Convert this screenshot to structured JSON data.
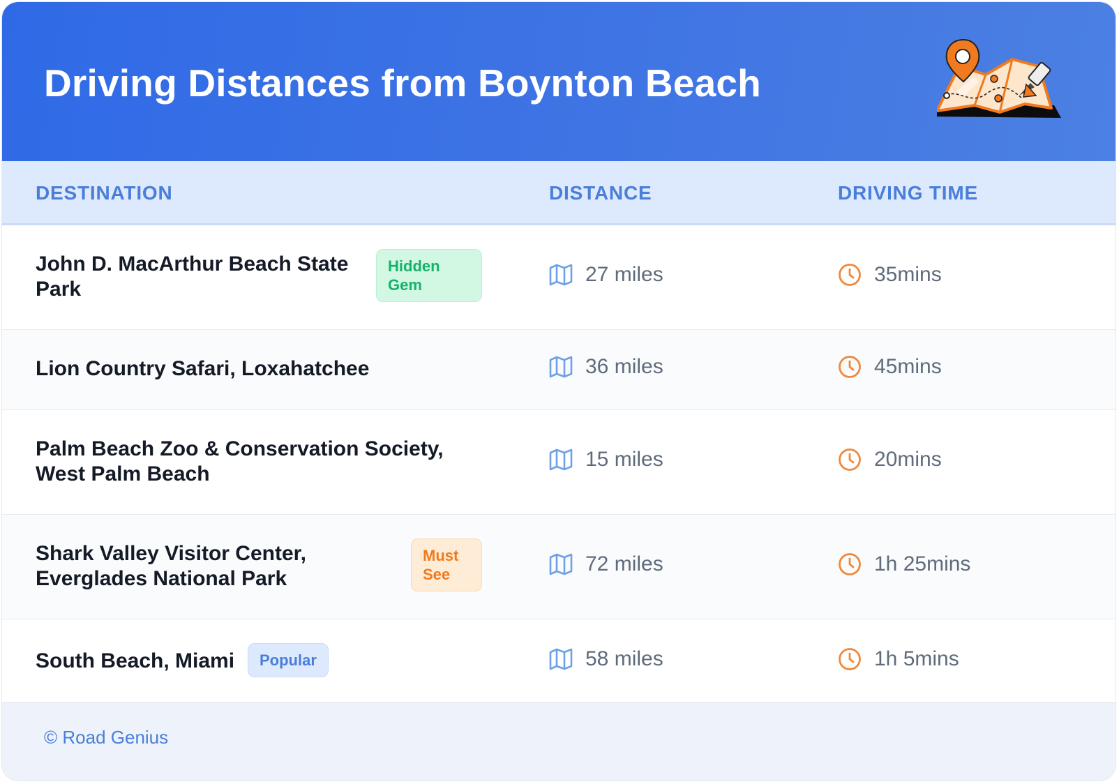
{
  "header": {
    "title": "Driving Distances from Boynton Beach",
    "illustration_icon": "map-with-pins-icon"
  },
  "columns": {
    "destination": "DESTINATION",
    "distance": "DISTANCE",
    "driving_time": "DRIVING TIME"
  },
  "rows": [
    {
      "destination": "John D. MacArthur Beach State Park",
      "badge": "Hidden Gem",
      "badge_color": "#17b26a",
      "distance": "27 miles",
      "time": "35mins"
    },
    {
      "destination": "Lion Country Safari, Loxahatchee",
      "badge": "",
      "distance": "36 miles",
      "time": "45mins"
    },
    {
      "destination": "Palm Beach Zoo & Conservation Society, West Palm Beach",
      "badge": "",
      "distance": "15 miles",
      "time": "20mins"
    },
    {
      "destination": "Shark Valley Visitor Center, Everglades National Park",
      "badge": "Must See",
      "badge_color": "#f07a1d",
      "distance": "72 miles",
      "time": "1h 25mins"
    },
    {
      "destination": "South Beach, Miami",
      "badge": "Popular",
      "badge_color": "#4a7ed9",
      "distance": "58 miles",
      "time": "1h 5mins"
    }
  ],
  "icons": {
    "distance": "map-icon",
    "time": "clock-icon"
  },
  "footer": {
    "text": "© Road Genius"
  },
  "colors": {
    "header_blue": "#2f6ae6",
    "accent_blue": "#4a7ed9",
    "accent_orange": "#f07a1d",
    "accent_green": "#17b26a"
  }
}
